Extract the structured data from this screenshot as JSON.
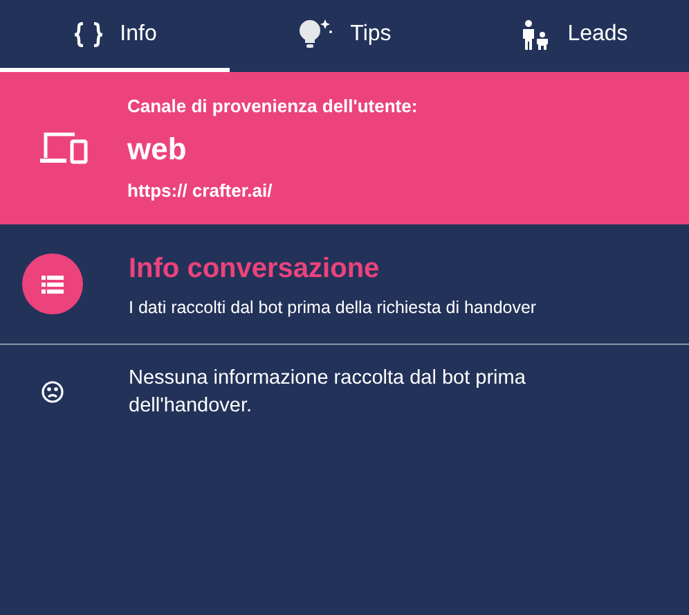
{
  "tabs": [
    {
      "kind": "braces",
      "label": "Info",
      "selected": true
    },
    {
      "kind": "bulb",
      "label": "Tips",
      "selected": false
    },
    {
      "kind": "people",
      "label": "Leads",
      "selected": false
    }
  ],
  "channel": {
    "heading": "Canale di provenienza dell'utente:",
    "value": "web",
    "url": "https:// crafter.ai/"
  },
  "conversation": {
    "title": "Info conversazione",
    "subtitle": "I dati raccolti dal bot prima della richiesta di handover"
  },
  "empty_message": "Nessuna informazione raccolta dal bot prima dell'handover."
}
